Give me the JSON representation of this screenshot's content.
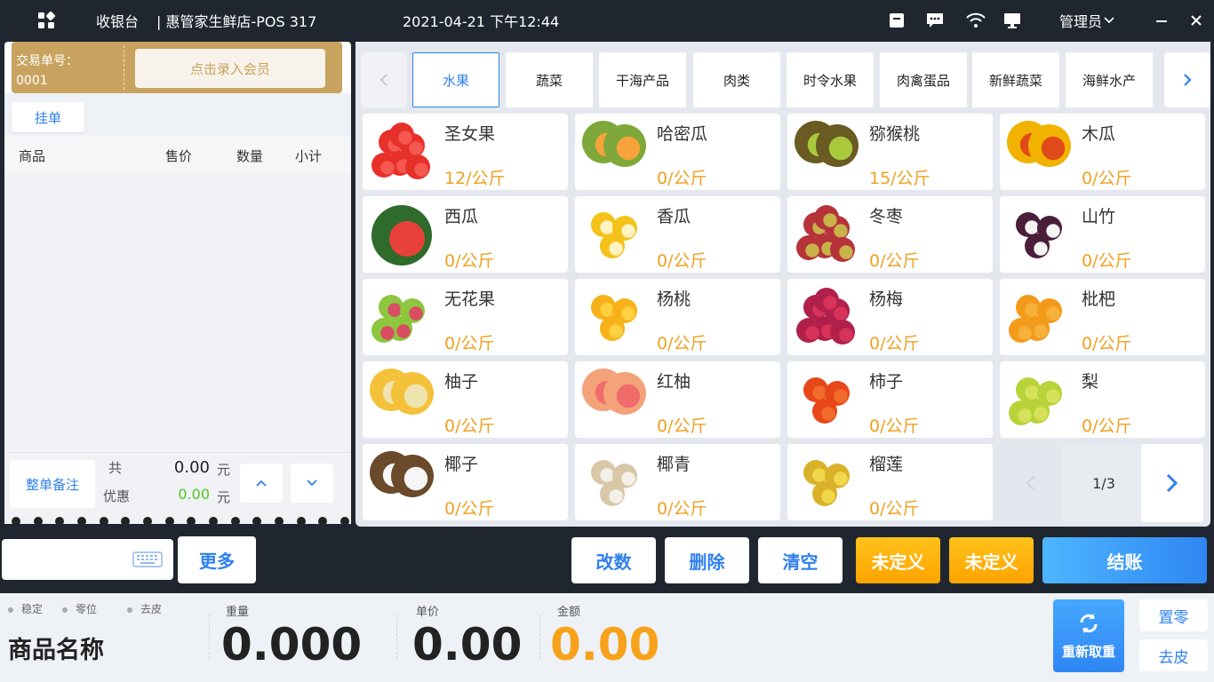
{
  "header": {
    "menu_icon": "grid-apps-icon",
    "title": "收银台",
    "store": "| 惠管家生鲜店-POS 317",
    "datetime": "2021-04-21 下午12:44",
    "user": "管理员",
    "icons": [
      "cash-drawer-icon",
      "message-icon",
      "wifi-icon",
      "monitor-icon",
      "chevron-down-icon",
      "minimize-icon",
      "close-icon"
    ]
  },
  "ticket": {
    "order_label": "交易单号：",
    "order_no": "0001",
    "member_button": "点击录入会员",
    "hold_button": "挂单"
  },
  "cart": {
    "columns": [
      "商品",
      "售价",
      "数量",
      "小计"
    ],
    "items": [],
    "note_button": "整单备注",
    "total_label": "共",
    "total_value": "0.00",
    "total_unit": "元",
    "discount_label": "优惠",
    "discount_value": "0.00",
    "discount_unit": "元"
  },
  "categories": [
    "水果",
    "蔬菜",
    "干海产品",
    "肉类",
    "时令水果",
    "肉禽蛋品",
    "新鲜蔬菜",
    "海鲜水产"
  ],
  "active_category": "水果",
  "products": [
    {
      "name": "圣女果",
      "price": "12/公斤"
    },
    {
      "name": "哈密瓜",
      "price": "0/公斤"
    },
    {
      "name": "猕猴桃",
      "price": "15/公斤"
    },
    {
      "name": "木瓜",
      "price": "0/公斤"
    },
    {
      "name": "西瓜",
      "price": "0/公斤"
    },
    {
      "name": "香瓜",
      "price": "0/公斤"
    },
    {
      "name": "冬枣",
      "price": "0/公斤"
    },
    {
      "name": "山竹",
      "price": "0/公斤"
    },
    {
      "name": "无花果",
      "price": "0/公斤"
    },
    {
      "name": "杨桃",
      "price": "0/公斤"
    },
    {
      "name": "杨梅",
      "price": "0/公斤"
    },
    {
      "name": "枇杷",
      "price": "0/公斤"
    },
    {
      "name": "柚子",
      "price": "0/公斤"
    },
    {
      "name": "红柚",
      "price": "0/公斤"
    },
    {
      "name": "柿子",
      "price": "0/公斤"
    },
    {
      "name": "梨",
      "price": "0/公斤"
    },
    {
      "name": "椰子",
      "price": "0/公斤"
    },
    {
      "name": "椰青",
      "price": "0/公斤"
    },
    {
      "name": "榴莲",
      "price": "0/公斤"
    }
  ],
  "pager": {
    "text": "1/3"
  },
  "actions": {
    "more": "更多",
    "edit_qty": "改数",
    "delete": "删除",
    "clear": "清空",
    "undefined1": "未定义",
    "undefined2": "未定义",
    "checkout": "结账"
  },
  "scale": {
    "flags": [
      "稳定",
      "零位",
      "去皮"
    ],
    "product_name": "商品名称",
    "weight_label": "重量",
    "weight": "0.000",
    "price_label": "单价",
    "price": "0.00",
    "amount_label": "金额",
    "amount": "0.00",
    "reweigh": "重新取重",
    "zero": "置零",
    "tare": "去皮"
  },
  "colors": {
    "accent": "#2f80ed",
    "price": "#f0a020",
    "gold": "#c8a35f",
    "dark": "#1f2630",
    "discount": "#52c41a"
  }
}
